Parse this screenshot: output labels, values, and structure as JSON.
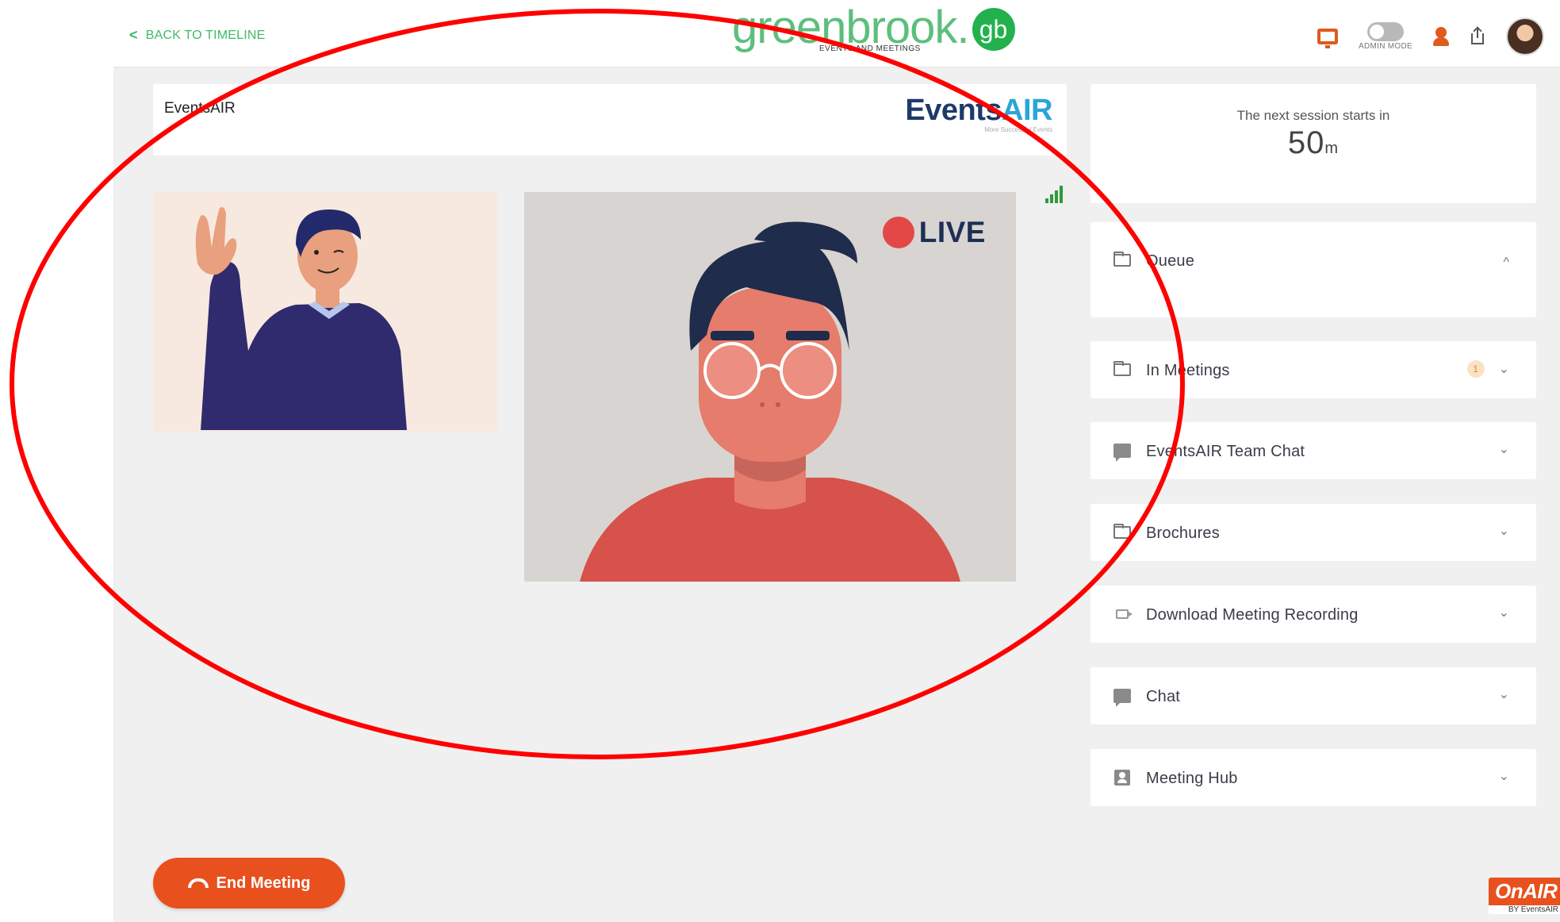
{
  "topbar": {
    "back_label": "BACK TO TIMELINE",
    "back_icon": "chevron-left-icon",
    "logo_word": "greenbrook.",
    "logo_badge": "gb",
    "logo_sub": "EVENTS AND MEETINGS",
    "admin_label": "ADMIN MODE",
    "icons": [
      "monitor-icon",
      "admin-toggle",
      "user-icon",
      "share-icon",
      "avatar"
    ]
  },
  "event": {
    "name": "EventsAIR",
    "logo_events": "Events",
    "logo_air": "AIR",
    "logo_tagline": "More Successful Events"
  },
  "stage": {
    "live_label": "LIVE",
    "signal_icon": "signal-bars-icon"
  },
  "sidebar": {
    "next_label": "The next session starts in",
    "next_value": "50",
    "next_unit": "m",
    "panels": [
      {
        "label": "Queue",
        "icon": "folder-icon",
        "state": "expanded",
        "caret": "^"
      },
      {
        "label": "In Meetings",
        "icon": "folder-icon",
        "badge": "1",
        "caret": "⌄"
      },
      {
        "label": "EventsAIR Team Chat",
        "icon": "chat-icon",
        "caret": "⌄"
      },
      {
        "label": "Brochures",
        "icon": "folder-icon",
        "caret": "⌄"
      },
      {
        "label": "Download Meeting Recording",
        "icon": "video-icon",
        "caret": "⌄"
      },
      {
        "label": "Chat",
        "icon": "chat-icon",
        "caret": "⌄"
      },
      {
        "label": "Meeting Hub",
        "icon": "hub-icon",
        "caret": "⌄"
      }
    ]
  },
  "footer": {
    "end_meeting_label": "End Meeting",
    "onair_label": "OnAIR",
    "onair_sub": "BY EventsAIR"
  },
  "colors": {
    "accent_green": "#3fb96a",
    "end_button": "#e8501e",
    "live_red": "#e34846",
    "annotation_red": "#ff0000",
    "page_bg": "#f0f0f0"
  }
}
